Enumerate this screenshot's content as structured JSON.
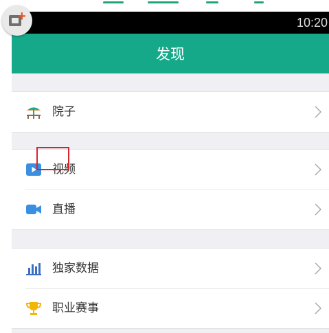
{
  "status_bar": {
    "time": "10:20"
  },
  "header": {
    "title": "发现"
  },
  "groups": [
    {
      "items": [
        {
          "icon": "courtyard-icon",
          "label": "院子"
        }
      ]
    },
    {
      "items": [
        {
          "icon": "video-play-icon",
          "label": "视频"
        },
        {
          "icon": "video-camera-icon",
          "label": "直播"
        }
      ]
    },
    {
      "items": [
        {
          "icon": "bar-chart-icon",
          "label": "独家数据"
        },
        {
          "icon": "trophy-icon",
          "label": "职业赛事"
        }
      ]
    }
  ],
  "highlight": {
    "label": "视频"
  },
  "colors": {
    "accent": "#15a98a",
    "status_bar": "#000000",
    "highlight_border": "#d9232d",
    "video_icon": "#3b8fe0",
    "chart_icon": "#3b6fc4",
    "trophy_icon": "#f2b705",
    "courtyard_icon": "#16a88a"
  }
}
